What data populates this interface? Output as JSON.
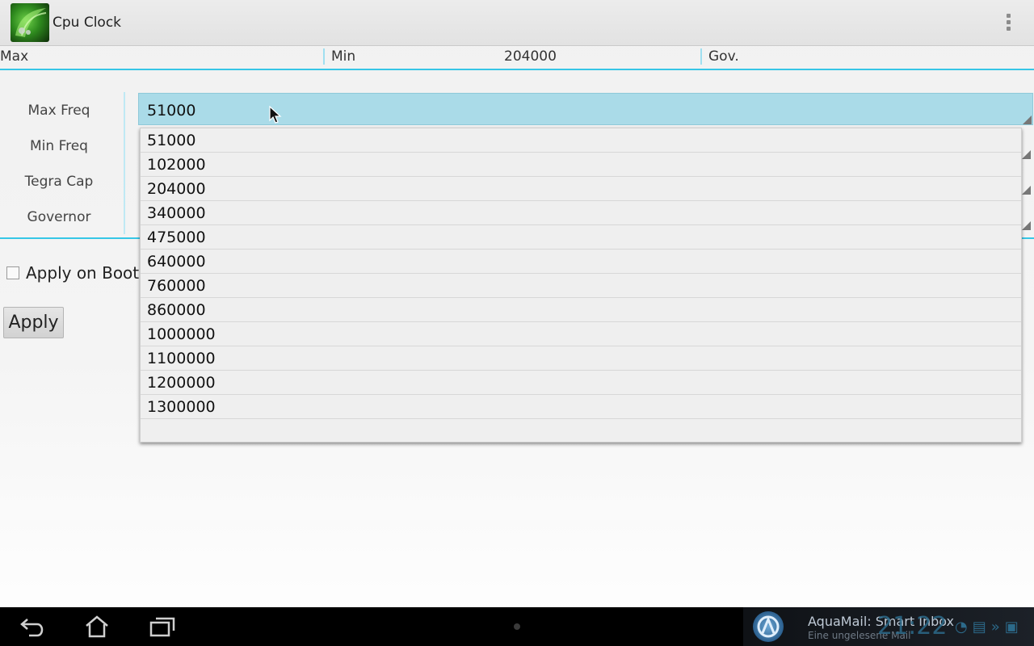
{
  "app": {
    "title": "Cpu Clock"
  },
  "info": {
    "max_label": "Max",
    "min_label": "Min",
    "min_value": "204000",
    "gov_label": "Gov."
  },
  "form": {
    "labels": [
      "Max Freq",
      "Min Freq",
      "Tegra Cap",
      "Governor"
    ],
    "selected_value": "51000",
    "apply_on_boot": "Apply on Boot",
    "apply_on_boot_checked": false,
    "apply_label": "Apply"
  },
  "dropdown": {
    "options": [
      "51000",
      "102000",
      "204000",
      "340000",
      "475000",
      "640000",
      "760000",
      "860000",
      "1000000",
      "1100000",
      "1200000",
      "1300000"
    ]
  },
  "system_bar": {
    "notification_title": "AquaMail: Smart Inbox",
    "notification_subtitle": "Eine ungelesene Mail",
    "clock": "21:22"
  },
  "icons": {
    "app": "cpu-clock-app-icon",
    "overflow": "overflow-menu-icon",
    "back": "back-icon",
    "home": "home-icon",
    "recents": "recent-apps-icon",
    "aquamail": "aquamail-icon",
    "wifi": "wifi-icon",
    "keyboard": "keyboard-icon",
    "more": "chevron-right-icon"
  },
  "colors": {
    "accent": "#36c6e6",
    "selected_spinner": "#aadbe8",
    "system_bar": "#000000"
  }
}
